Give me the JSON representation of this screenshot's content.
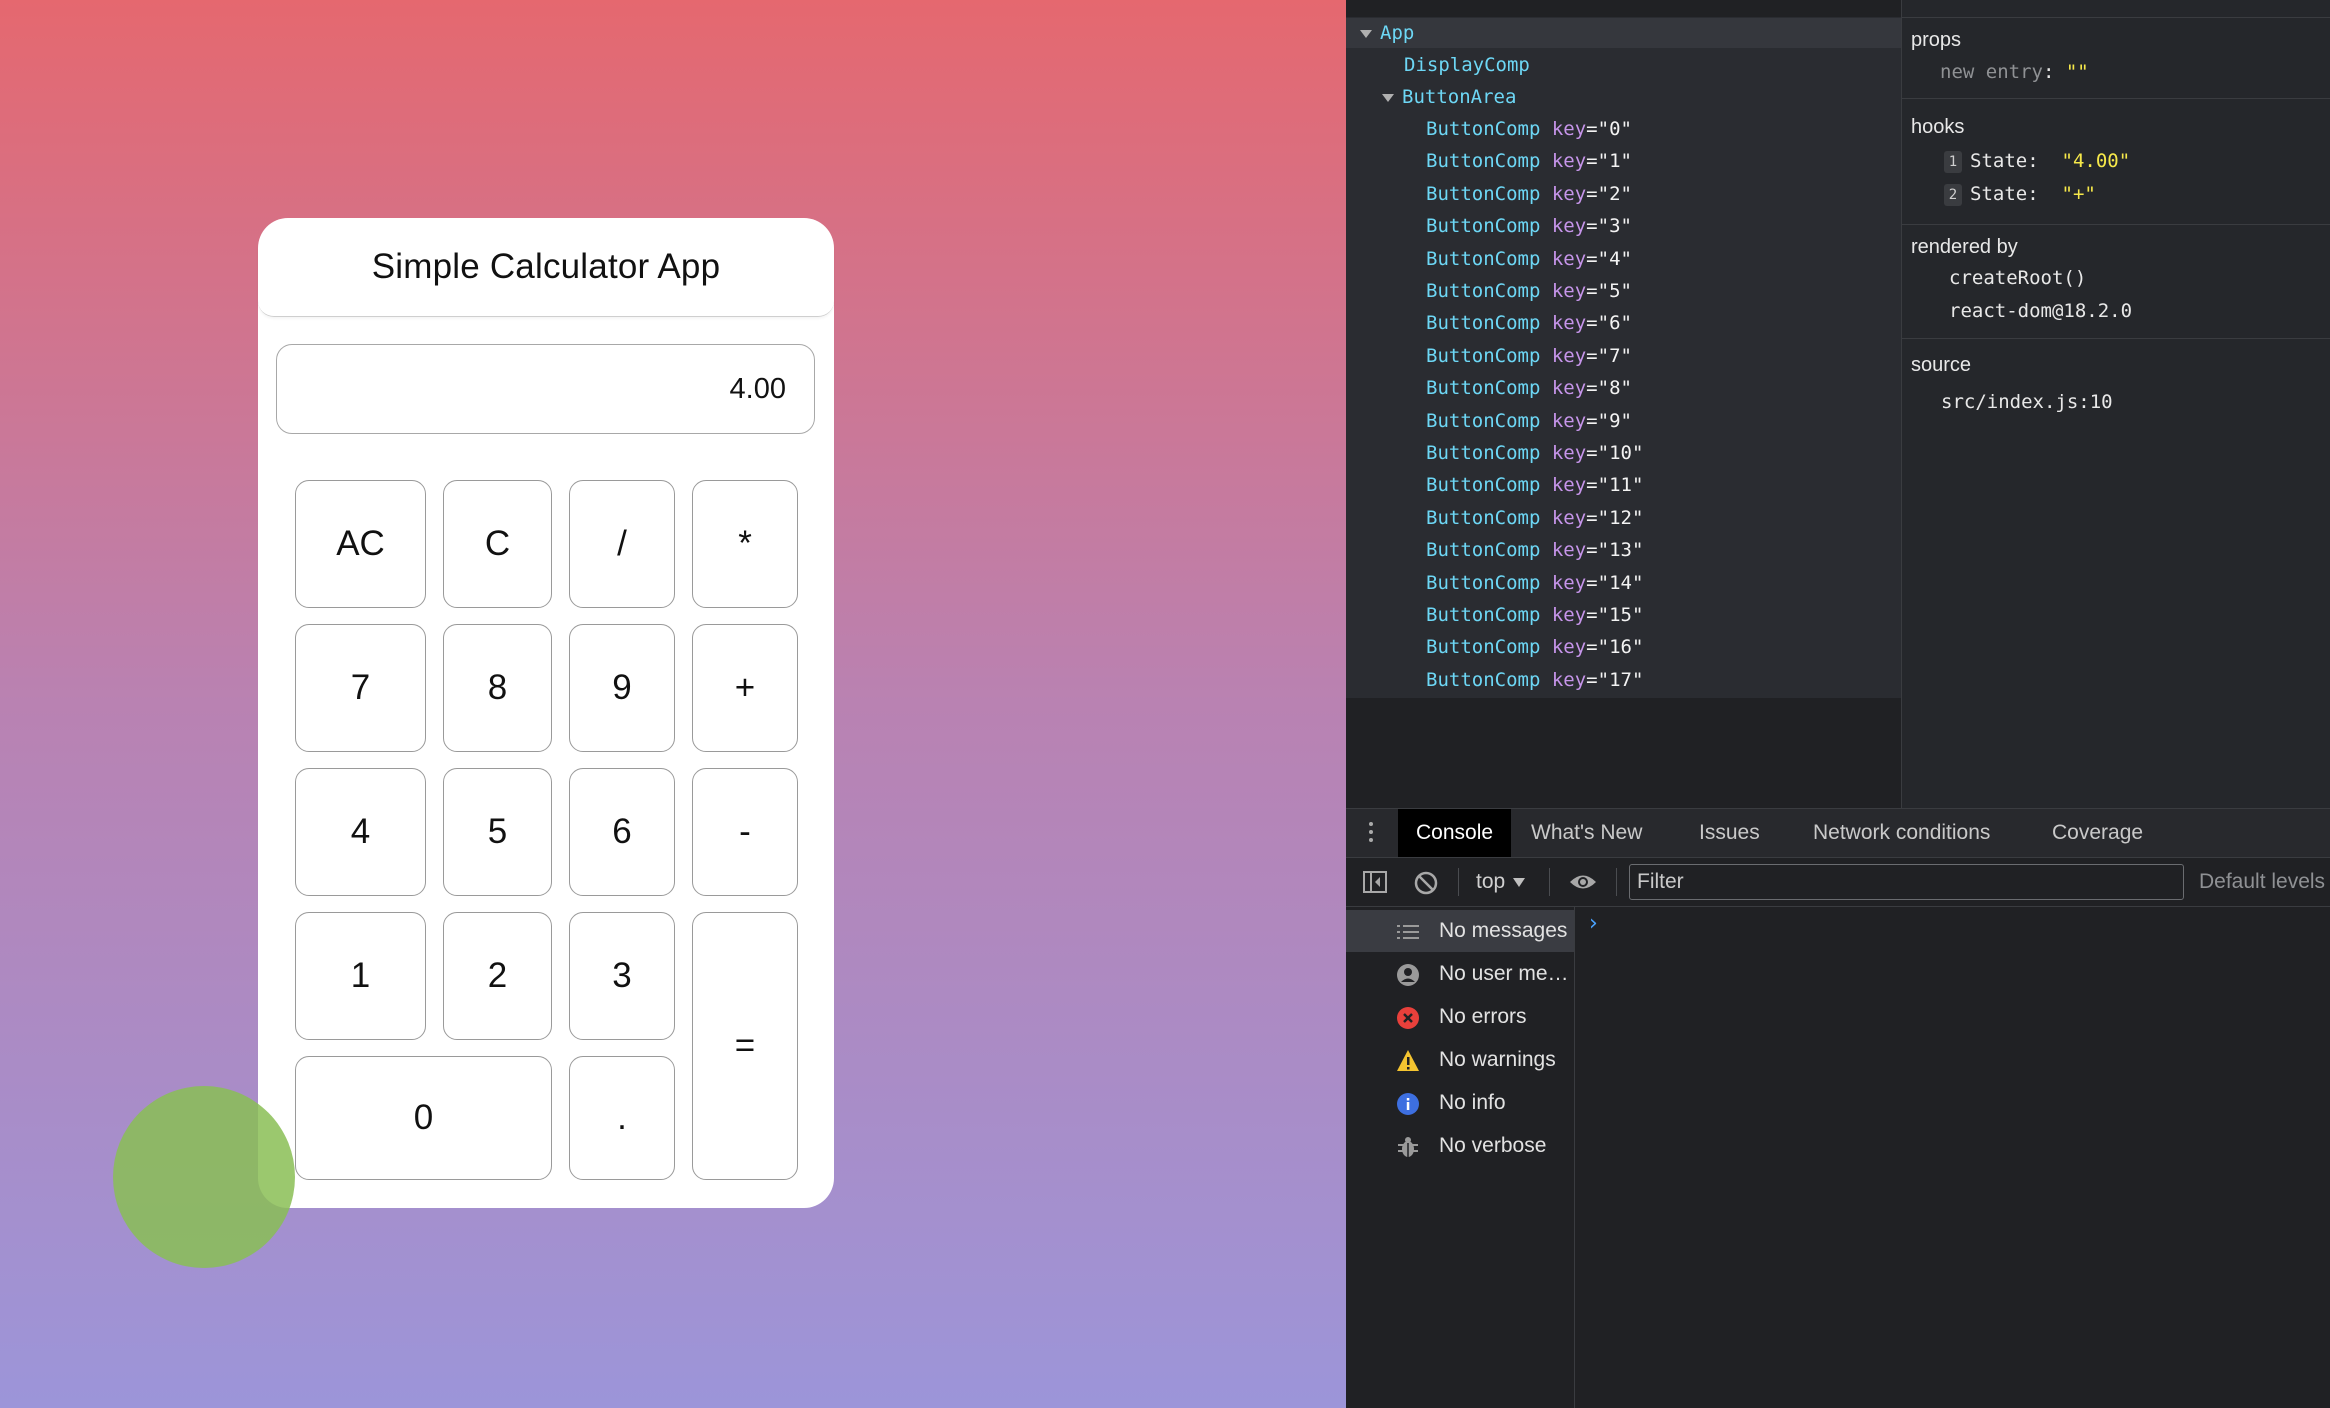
{
  "calculator": {
    "title": "Simple Calculator App",
    "display_value": "4.00",
    "buttons": {
      "ac": "AC",
      "c": "C",
      "divide": "/",
      "multiply": "*",
      "seven": "7",
      "eight": "8",
      "nine": "9",
      "plus": "+",
      "four": "4",
      "five": "5",
      "six": "6",
      "minus": "-",
      "one": "1",
      "two": "2",
      "three": "3",
      "equals": "=",
      "zero": "0",
      "dot": "."
    }
  },
  "devtools": {
    "tree": {
      "root": "App",
      "display": "DisplayComp",
      "button_area": "ButtonArea",
      "button_comp": "ButtonComp",
      "key_attr": "key",
      "keys": [
        "\"0\"",
        "\"1\"",
        "\"2\"",
        "\"3\"",
        "\"4\"",
        "\"5\"",
        "\"6\"",
        "\"7\"",
        "\"8\"",
        "\"9\"",
        "\"10\"",
        "\"11\"",
        "\"12\"",
        "\"13\"",
        "\"14\"",
        "\"15\"",
        "\"16\"",
        "\"17\""
      ]
    },
    "side": {
      "props_heading": "props",
      "props_key": "new entry",
      "props_val": "\"\"",
      "hooks_heading": "hooks",
      "hooks": [
        {
          "index": "1",
          "label": "State:",
          "value": "\"4.00\""
        },
        {
          "index": "2",
          "label": "State:",
          "value": "\"+\""
        }
      ],
      "rendered_heading": "rendered by",
      "rendered": [
        "createRoot()",
        "react-dom@18.2.0"
      ],
      "source_heading": "source",
      "source": "src/index.js:10"
    },
    "drawer": {
      "tabs": [
        "Console",
        "What's New",
        "Issues",
        "Network conditions",
        "Coverage"
      ],
      "context": "top",
      "filter_placeholder": "Filter",
      "levels": "Default levels",
      "messages": [
        {
          "label": "No messages",
          "icon": "list-icon"
        },
        {
          "label": "No user me…",
          "icon": "user-icon"
        },
        {
          "label": "No errors",
          "icon": "error-icon"
        },
        {
          "label": "No warnings",
          "icon": "warning-icon"
        },
        {
          "label": "No info",
          "icon": "info-icon"
        },
        {
          "label": "No verbose",
          "icon": "bug-icon"
        }
      ],
      "prompt": "›"
    }
  },
  "colors": {
    "gradient_top": "#e5686f",
    "gradient_bottom": "#9c95d9",
    "component": "#6dd7f5",
    "attr_key": "#c695ea",
    "string_yellow": "#f6e84a",
    "error_red": "#e8403b",
    "warning_yellow": "#f4c430",
    "info_blue": "#3d6fe0"
  }
}
